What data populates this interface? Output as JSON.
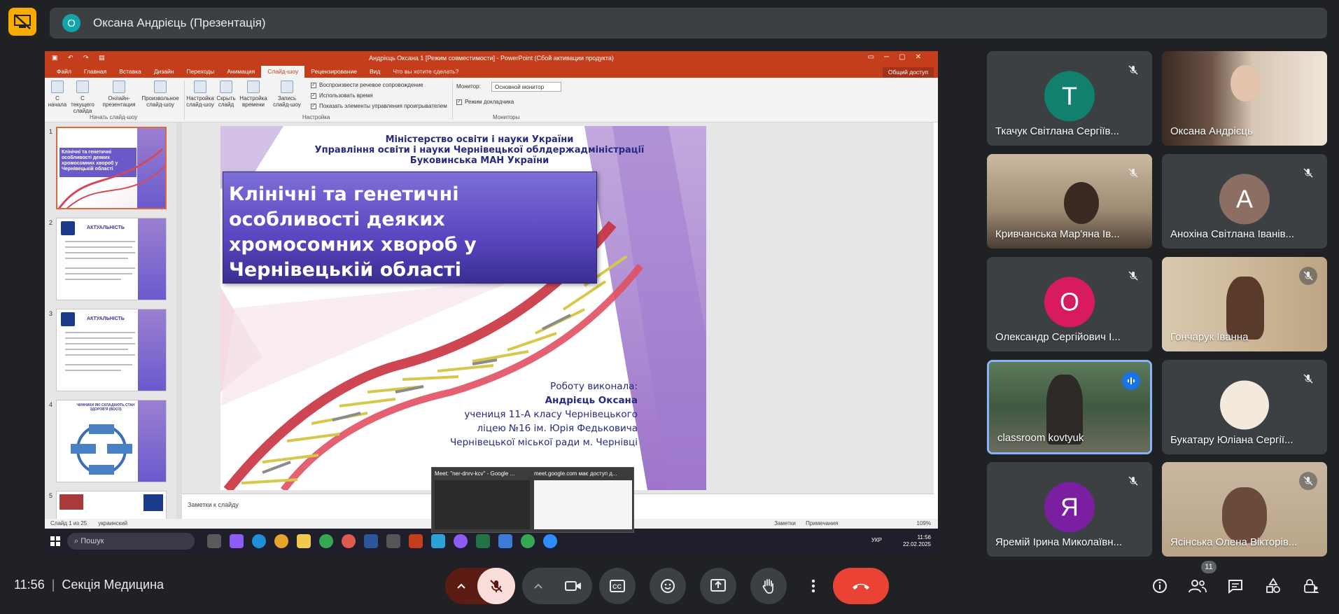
{
  "meet": {
    "presenter_name": "Оксана Андрієць (Презентація)",
    "presenter_initial": "О",
    "time": "11:56",
    "meeting_name": "Секція Медицина",
    "participant_count": "11",
    "accent_color": "#1a73e8",
    "end_call_color": "#ea4335"
  },
  "ppt": {
    "window_title": "Андрієць Оксана 1 [Режим совместимости] - PowerPoint (Сбой активации продукта)",
    "tabs": [
      "Файл",
      "Главная",
      "Вставка",
      "Дизайн",
      "Переходы",
      "Анимация",
      "Слайд-шоу",
      "Рецензирование",
      "Вид"
    ],
    "active_tab": "Слайд-шоу",
    "tell_me": "Что вы хотите сделать?",
    "share": "Общий доступ",
    "ribbon": {
      "btn_from_start": "С начала",
      "btn_from_current": "С текущего слайда",
      "btn_online": "Онлайн-презентация",
      "btn_custom": "Произвольное слайд-шоу",
      "group_start": "Начать слайд-шоу",
      "btn_setup": "Настройка слайд-шоу",
      "btn_hide": "Скрыть слайд",
      "btn_rehearse": "Настройка времени",
      "btn_record": "Запись слайд-шоу",
      "chk_narration": "Воспроизвести речевое сопровождение",
      "chk_timings": "Использовать время",
      "chk_media": "Показать элементы управления проигрывателем",
      "group_setup": "Настройка",
      "monitor_label": "Монитор:",
      "monitor_value": "Основной монитор",
      "chk_presenter": "Режим докладчика",
      "group_monitors": "Мониторы"
    },
    "thumbnails": [
      {
        "num": "1",
        "title": "Клінічні та генетичні особливості деяких хромосомних хвороб у Чернівецькій області"
      },
      {
        "num": "2",
        "title": "АКТУАЛЬНІСТЬ"
      },
      {
        "num": "3",
        "title": "АКТУАЛЬНІСТЬ"
      },
      {
        "num": "4",
        "title": "ЧИННИКИ ЯКІ СКЛАДАЮТЬ СТАН ЗДОРОВ'Я (ВООЗ)"
      },
      {
        "num": "5",
        "title": ""
      }
    ],
    "slide": {
      "header_line1": "Міністерство освіти і науки України",
      "header_line2": "Управління освіти і науки Чернівецької облдержадміністрації",
      "header_line3": "Буковинська МАН України",
      "title": "Клінічні та генетичні особливості деяких хромосомних хвороб у Чернівецькій області",
      "author_line1": "Роботу виконала:",
      "author_line2": "Андрієць Оксана",
      "author_line3": "учениця 11-А класу Чернівецького",
      "author_line4": "ліцею №16 ім. Юрія Федьковича",
      "author_line5": "Чернівецької міської ради м. Чернівці"
    },
    "notes_placeholder": "Заметки к слайду",
    "status_slide": "Слайд 1 из 25",
    "status_lang": "украинский",
    "status_notes": "Заметки",
    "status_comments": "Примечания",
    "zoom": "109%"
  },
  "taskbar": {
    "search": "Пошук",
    "lang": "УКР",
    "time": "11:56",
    "date": "22.02.2025"
  },
  "popup": {
    "tab1": "Meet: \"ner-dnrv-kcv\" - Google ...",
    "tab2": "meet.google.com має доступ д..."
  },
  "participants": [
    {
      "name": "Ткачук Світлана Сергіїв...",
      "initial": "Т",
      "color": "#12806e",
      "mic": "muted"
    },
    {
      "name": "Оксана Андрієць",
      "initial": "",
      "color": "",
      "mic": "none"
    },
    {
      "name": "Кривчанська Мар'яна Ів...",
      "initial": "",
      "color": "",
      "mic": "muted"
    },
    {
      "name": "Анохіна Світлана Іванів...",
      "initial": "А",
      "color": "#8d6e63",
      "mic": "muted"
    },
    {
      "name": "Олександр Сергійович І...",
      "initial": "О",
      "color": "#d81b60",
      "mic": "muted"
    },
    {
      "name": "Гончарук Іванна",
      "initial": "",
      "color": "",
      "mic": "muted"
    },
    {
      "name": "classroom kovtyuk",
      "initial": "",
      "color": "",
      "mic": "speaking"
    },
    {
      "name": "Букатару Юліана Сергії...",
      "initial": "",
      "color": "",
      "mic": "muted"
    },
    {
      "name": "Яремій Ірина Миколаївн...",
      "initial": "Я",
      "color": "#7b1fa2",
      "mic": "muted"
    },
    {
      "name": "Ясінська Олена Вікторів...",
      "initial": "",
      "color": "",
      "mic": "muted"
    }
  ]
}
